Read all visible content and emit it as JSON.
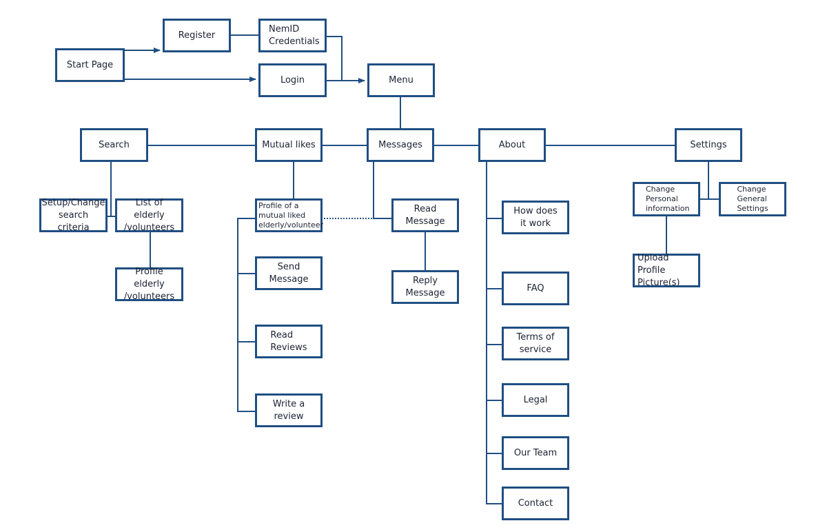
{
  "diagram": {
    "type": "sitemap",
    "colors": {
      "stroke": "#1f4e82",
      "text": "#1c2233",
      "background": "#ffffff"
    },
    "nodes": {
      "start_page": "Start Page",
      "register": "Register",
      "nemid": "NemID\nCredentials",
      "login": "Login",
      "menu": "Menu",
      "search": "Search",
      "mutual_likes": "Mutual likes",
      "messages": "Messages",
      "about": "About",
      "settings": "Settings",
      "setup_search": "Setup/Change\nsearch criteria",
      "list_elderly": "List of elderly\n/volunteers",
      "profile_elderly": "Profile elderly\n/volunteers",
      "profile_mutual": "Profile of a\nmutual liked\nelderly/volunteer",
      "send_message": "Send Message",
      "read_reviews": "Read\nReviews",
      "write_review": "Write a review",
      "read_message": "Read Message",
      "reply_message": "Reply Message",
      "how_it_works": "How does\nit work",
      "faq": "FAQ",
      "terms": "Terms of\nservice",
      "legal": "Legal",
      "our_team": "Our Team",
      "contact": "Contact",
      "change_personal": "Change\nPersonal\ninformation",
      "change_general": "Change\nGeneral\nSettings",
      "upload_picture": "Upload Profile\nPicture(s)"
    },
    "edges": [
      {
        "from": "start_page",
        "to": "register",
        "style": "arrow"
      },
      {
        "from": "start_page",
        "to": "login",
        "style": "arrow"
      },
      {
        "from": "register",
        "to": "nemid",
        "style": "line"
      },
      {
        "from": "nemid",
        "to": "menu",
        "style": "arrow"
      },
      {
        "from": "login",
        "to": "menu",
        "style": "arrow"
      },
      {
        "from": "menu",
        "to": "messages",
        "style": "line"
      },
      {
        "from": "messages",
        "to": "mutual_likes",
        "style": "line"
      },
      {
        "from": "mutual_likes",
        "to": "search",
        "style": "line"
      },
      {
        "from": "messages",
        "to": "about",
        "style": "line"
      },
      {
        "from": "about",
        "to": "settings",
        "style": "line"
      },
      {
        "from": "search",
        "to": "setup_search",
        "style": "line"
      },
      {
        "from": "search",
        "to": "list_elderly",
        "style": "line"
      },
      {
        "from": "list_elderly",
        "to": "profile_elderly",
        "style": "line"
      },
      {
        "from": "mutual_likes",
        "to": "profile_mutual",
        "style": "line"
      },
      {
        "from": "profile_mutual",
        "to": "send_message",
        "style": "line"
      },
      {
        "from": "profile_mutual",
        "to": "read_reviews",
        "style": "line"
      },
      {
        "from": "profile_mutual",
        "to": "write_review",
        "style": "line"
      },
      {
        "from": "profile_mutual",
        "to": "read_message",
        "style": "dotted"
      },
      {
        "from": "messages",
        "to": "read_message",
        "style": "line"
      },
      {
        "from": "read_message",
        "to": "reply_message",
        "style": "line"
      },
      {
        "from": "about",
        "to": "how_it_works",
        "style": "line"
      },
      {
        "from": "about",
        "to": "faq",
        "style": "line"
      },
      {
        "from": "about",
        "to": "terms",
        "style": "line"
      },
      {
        "from": "about",
        "to": "legal",
        "style": "line"
      },
      {
        "from": "about",
        "to": "our_team",
        "style": "line"
      },
      {
        "from": "about",
        "to": "contact",
        "style": "line"
      },
      {
        "from": "settings",
        "to": "change_personal",
        "style": "line"
      },
      {
        "from": "settings",
        "to": "change_general",
        "style": "line"
      },
      {
        "from": "change_personal",
        "to": "upload_picture",
        "style": "line"
      }
    ]
  }
}
